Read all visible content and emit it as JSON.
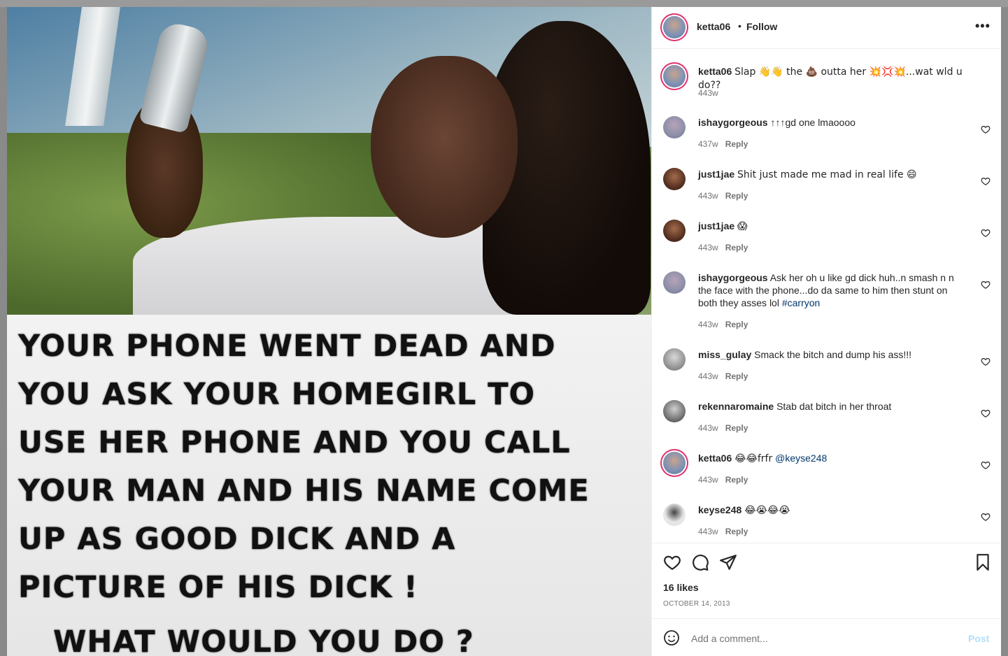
{
  "post": {
    "caption_lines": [
      "YOUR PHONE WENT DEAD AND",
      "YOU ASK YOUR HOMEGIRL TO",
      "USE HER PHONE AND YOU CALL",
      "YOUR MAN AND HIS NAME COME",
      "UP AS GOOD DICK AND A",
      "PICTURE OF HIS DICK !",
      "WHAT WOULD YOU  DO ?"
    ]
  },
  "header": {
    "username": "ketta06",
    "dot": "•",
    "follow_label": "Follow",
    "more_icon": "more-options-icon"
  },
  "comments": [
    {
      "user": "ketta06",
      "text": "Slap 👋👋 the 💩 outta her 💥💢💥...wat wld u do??",
      "time": "443w",
      "reply": ""
    },
    {
      "user": "ishaygorgeous",
      "text": "↑↑↑gd one lmaoooo",
      "time": "437w",
      "reply": "Reply"
    },
    {
      "user": "just1jae",
      "text": "Shit just made me mad in real life 😄",
      "time": "443w",
      "reply": "Reply"
    },
    {
      "user": "just1jae",
      "text": "😱",
      "time": "443w",
      "reply": "Reply"
    },
    {
      "user": "ishaygorgeous",
      "text": "Ask her oh u like gd dick huh..n smash n n the face with the phone...do da same to him then stunt on both they asses lol",
      "hashtag": "#carryon",
      "time": "443w",
      "reply": "Reply"
    },
    {
      "user": "miss_gulay",
      "text": "Smack the bitch and dump his ass!!!",
      "time": "443w",
      "reply": "Reply"
    },
    {
      "user": "rekennaromaine",
      "text": "Stab dat bitch in her throat",
      "time": "443w",
      "reply": "Reply"
    },
    {
      "user": "ketta06",
      "text": "😂😂frfr",
      "mention": "@keyse248",
      "time": "443w",
      "reply": "Reply"
    },
    {
      "user": "keyse248",
      "text": "😂😭😂😭",
      "time": "443w",
      "reply": "Reply"
    }
  ],
  "actions": {
    "likes": "16 likes",
    "date": "OCTOBER 14, 2013"
  },
  "add_comment": {
    "placeholder": "Add a comment...",
    "post_label": "Post"
  },
  "colors": {
    "text": "#262626",
    "secondary": "#737373",
    "link": "#00376b",
    "post_disabled": "#b2dffc",
    "story_ring": "#e1306c"
  }
}
